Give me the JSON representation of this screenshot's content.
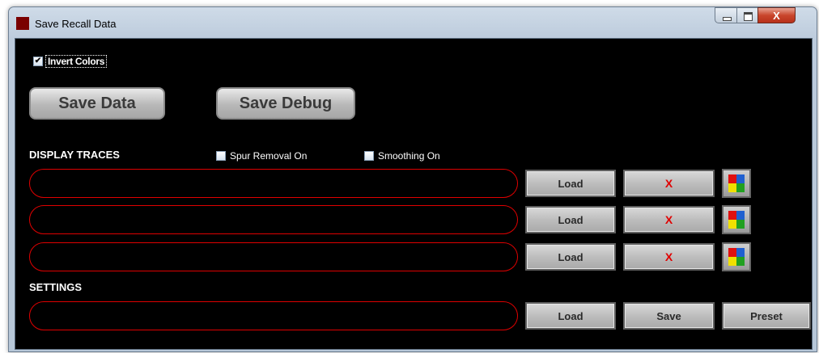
{
  "window": {
    "title": "Save Recall Data",
    "controls": {
      "minimize": "–",
      "maximize": "□",
      "close": "X"
    }
  },
  "invert_colors": {
    "label": "Invert Colors",
    "checked": true
  },
  "actions": {
    "save_data": "Save Data",
    "save_debug": "Save Debug"
  },
  "display_traces": {
    "title": "DISPLAY TRACES",
    "spur_removal": {
      "label": "Spur Removal On",
      "checked": false
    },
    "smoothing": {
      "label": "Smoothing On",
      "checked": false
    },
    "traces": [
      {
        "value": "",
        "load": "Load",
        "clear": "X"
      },
      {
        "value": "",
        "load": "Load",
        "clear": "X"
      },
      {
        "value": "",
        "load": "Load",
        "clear": "X"
      }
    ],
    "color_icon_colors": [
      "#e01010",
      "#2060d0",
      "#f0e000",
      "#20a020"
    ]
  },
  "settings": {
    "title": "SETTINGS",
    "value": "",
    "load": "Load",
    "save": "Save",
    "preset": "Preset"
  },
  "colors": {
    "accent_red": "#e00000",
    "background": "#000000"
  }
}
